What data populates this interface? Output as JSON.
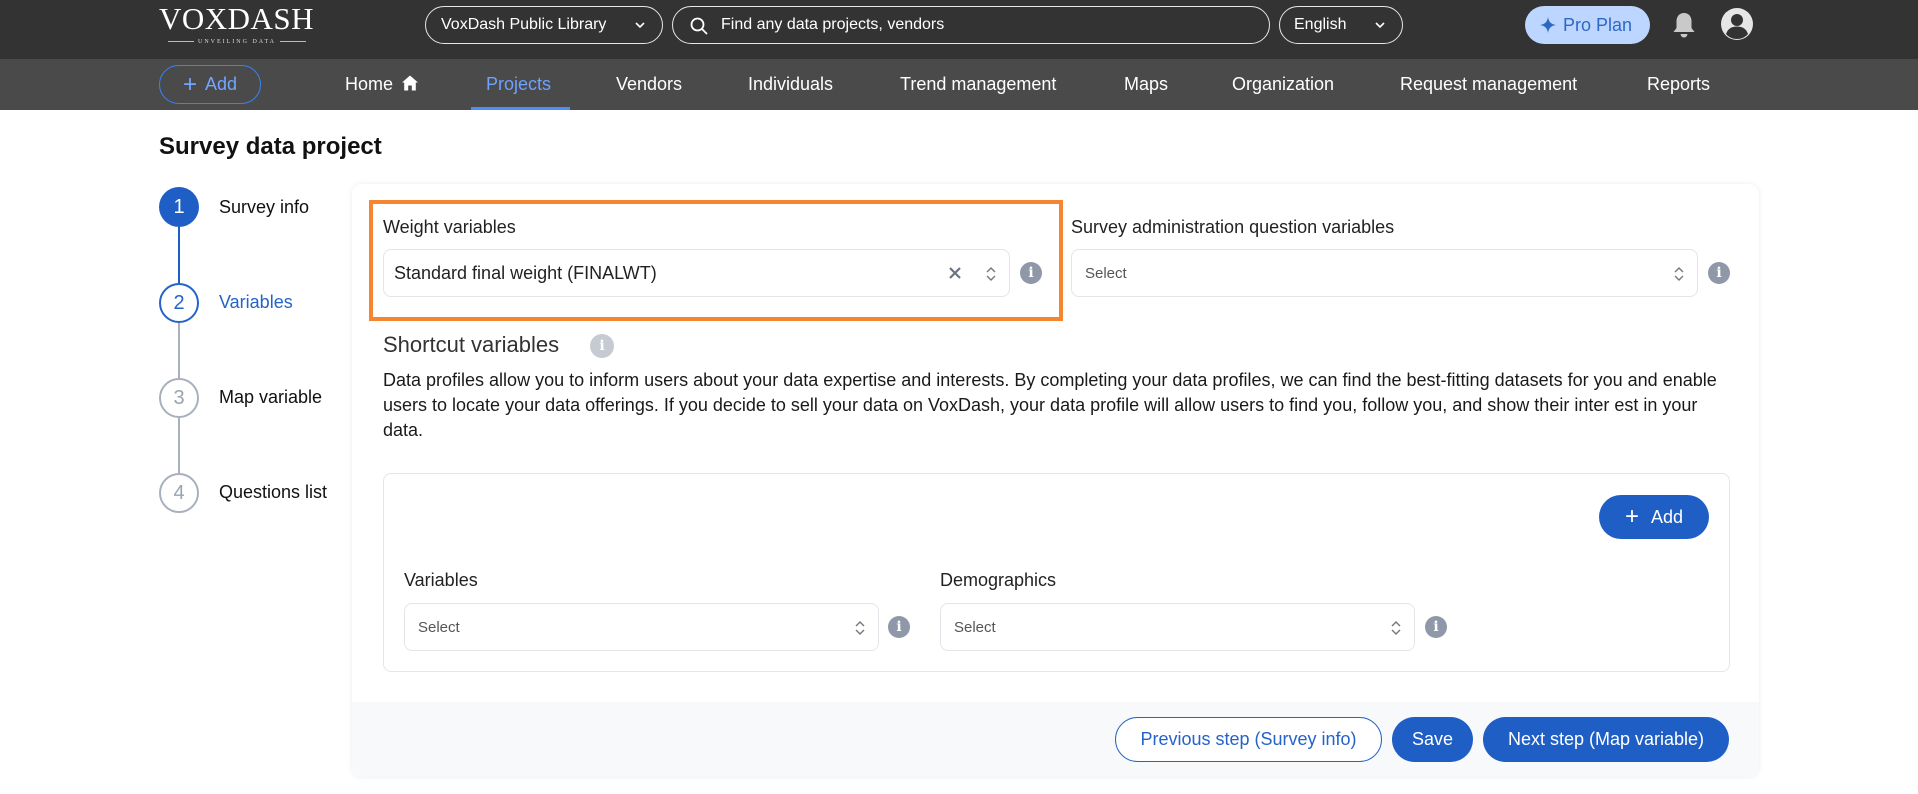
{
  "header": {
    "logo_text": "VOXDASH",
    "logo_tagline": "UNVEILING DATA",
    "library_select": "VoxDash Public Library",
    "search_placeholder": "Find any data projects, vendors",
    "language_select": "English",
    "pro_plan_label": "Pro Plan"
  },
  "nav": {
    "add_label": "Add",
    "items": [
      "Home",
      "Projects",
      "Vendors",
      "Individuals",
      "Trend management",
      "Maps",
      "Organization",
      "Request management",
      "Reports"
    ],
    "active": "Projects"
  },
  "page": {
    "title": "Survey data project"
  },
  "steps": [
    {
      "number": "1",
      "label": "Survey info",
      "state": "done"
    },
    {
      "number": "2",
      "label": "Variables",
      "state": "current"
    },
    {
      "number": "3",
      "label": "Map variable",
      "state": "todo"
    },
    {
      "number": "4",
      "label": "Questions list",
      "state": "todo"
    }
  ],
  "form": {
    "weight_label": "Weight variables",
    "weight_value": "Standard final weight (FINALWT)",
    "survey_admin_label": "Survey administration question variables",
    "survey_admin_placeholder": "Select",
    "shortcut_title": "Shortcut variables",
    "shortcut_description": "Data profiles allow you to inform users about your data expertise and interests. By completing your data profiles, we can find the best-fitting datasets for you and enable users to locate your data offerings. If you decide to sell your data on VoxDash, your data profile will allow users to find you, follow you, and show their inter est in your data.",
    "add_label": "Add",
    "variables_label": "Variables",
    "variables_placeholder": "Select",
    "demographics_label": "Demographics",
    "demographics_placeholder": "Select"
  },
  "footer": {
    "previous_label": "Previous step (Survey info)",
    "save_label": "Save",
    "next_label": "Next step (Map variable)"
  },
  "colors": {
    "primary": "#1f5fc5",
    "highlight": "#f5852e",
    "topbar": "#333333",
    "navbar": "#4a4a4a"
  }
}
